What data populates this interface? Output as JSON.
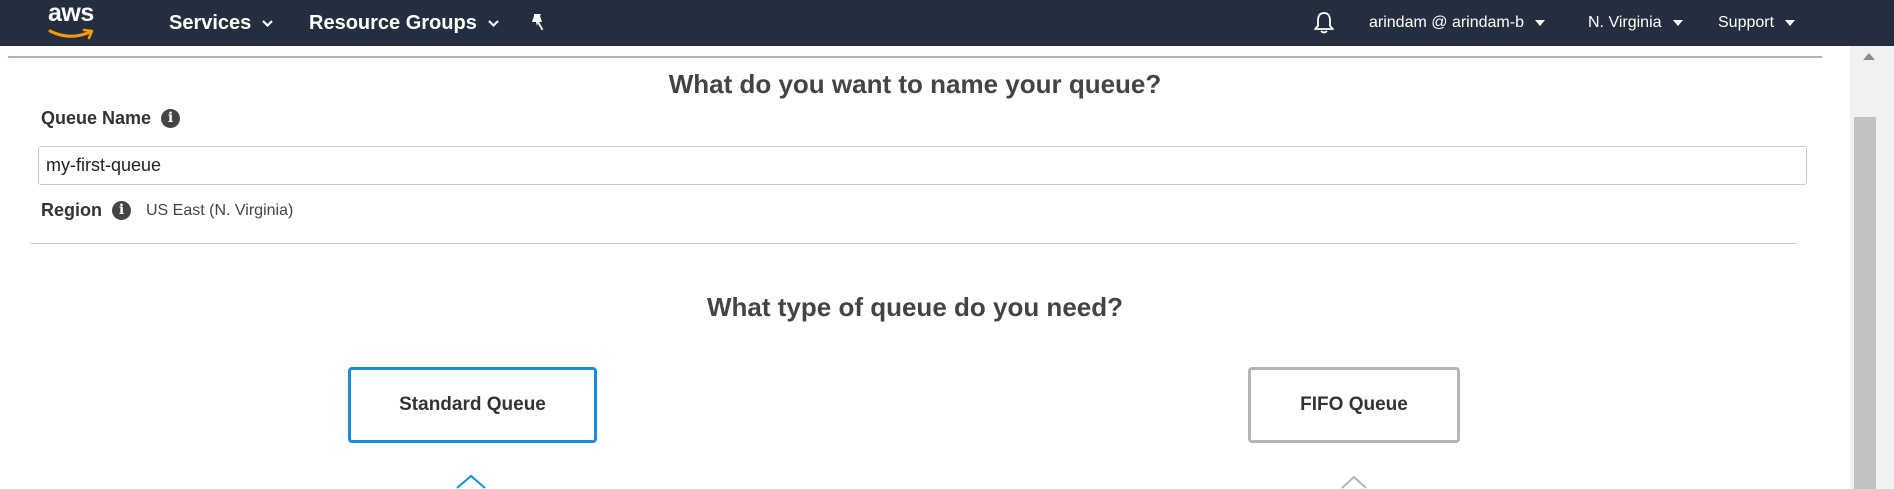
{
  "header": {
    "logo": "aws",
    "services": "Services",
    "resource_groups": "Resource Groups",
    "account": "arindam @ arindam-b",
    "region": "N. Virginia",
    "support": "Support"
  },
  "name_section": {
    "heading": "What do you want to name your queue?",
    "queue_name_label": "Queue Name",
    "queue_name_value": "my-first-queue",
    "region_label": "Region",
    "region_value": "US East (N. Virginia)"
  },
  "type_section": {
    "heading": "What type of queue do you need?",
    "standard_label": "Standard Queue",
    "fifo_label": "FIFO Queue"
  },
  "colors": {
    "nav_bg": "#232f3e",
    "selected_border": "#1a8fd8",
    "unselected_border": "#b5b5b5",
    "aws_smile": "#ff9900"
  },
  "icons": {
    "bell": "bell-icon",
    "pin": "pin-icon",
    "info": "info-icon"
  }
}
